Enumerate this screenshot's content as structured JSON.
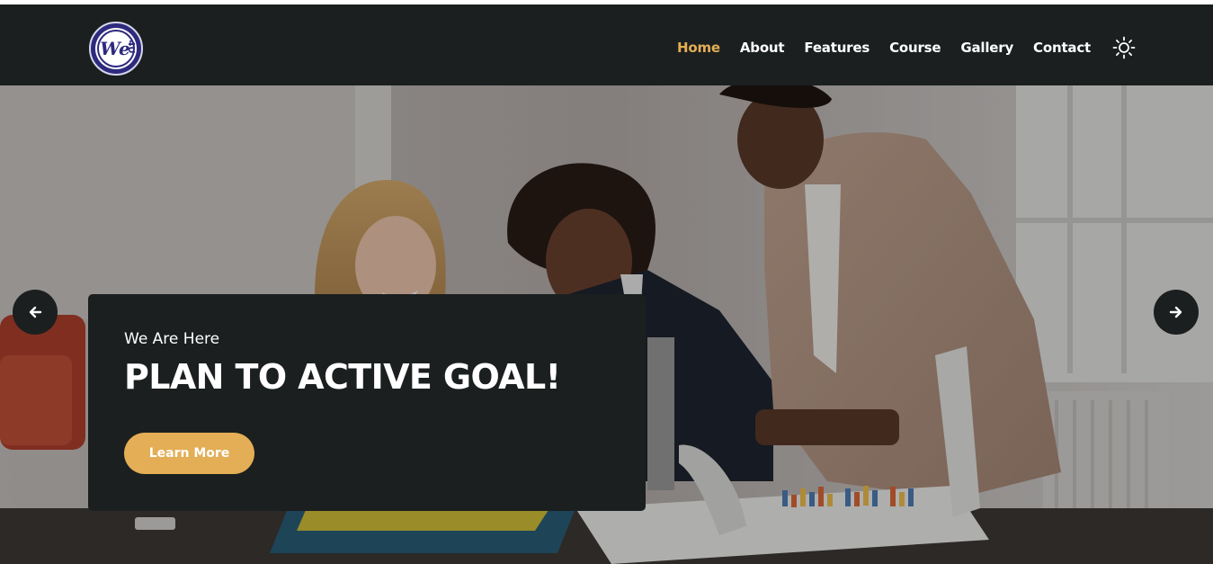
{
  "nav": {
    "items": [
      {
        "label": "Home",
        "active": true
      },
      {
        "label": "About",
        "active": false
      },
      {
        "label": "Features",
        "active": false
      },
      {
        "label": "Course",
        "active": false
      },
      {
        "label": "Gallery",
        "active": false
      },
      {
        "label": "Contact",
        "active": false
      }
    ],
    "theme_toggle_icon": "sun-icon"
  },
  "logo": {
    "icon": "brand-logo"
  },
  "hero": {
    "eyebrow": "We Are Here",
    "headline": "PLAN TO ACTIVE GOAL!",
    "cta_label": "Learn More",
    "prev_icon": "arrow-left-icon",
    "next_icon": "arrow-right-icon"
  },
  "colors": {
    "navbar_bg": "#1b1f1f",
    "accent": "#e3ae55",
    "text": "#ffffff"
  }
}
